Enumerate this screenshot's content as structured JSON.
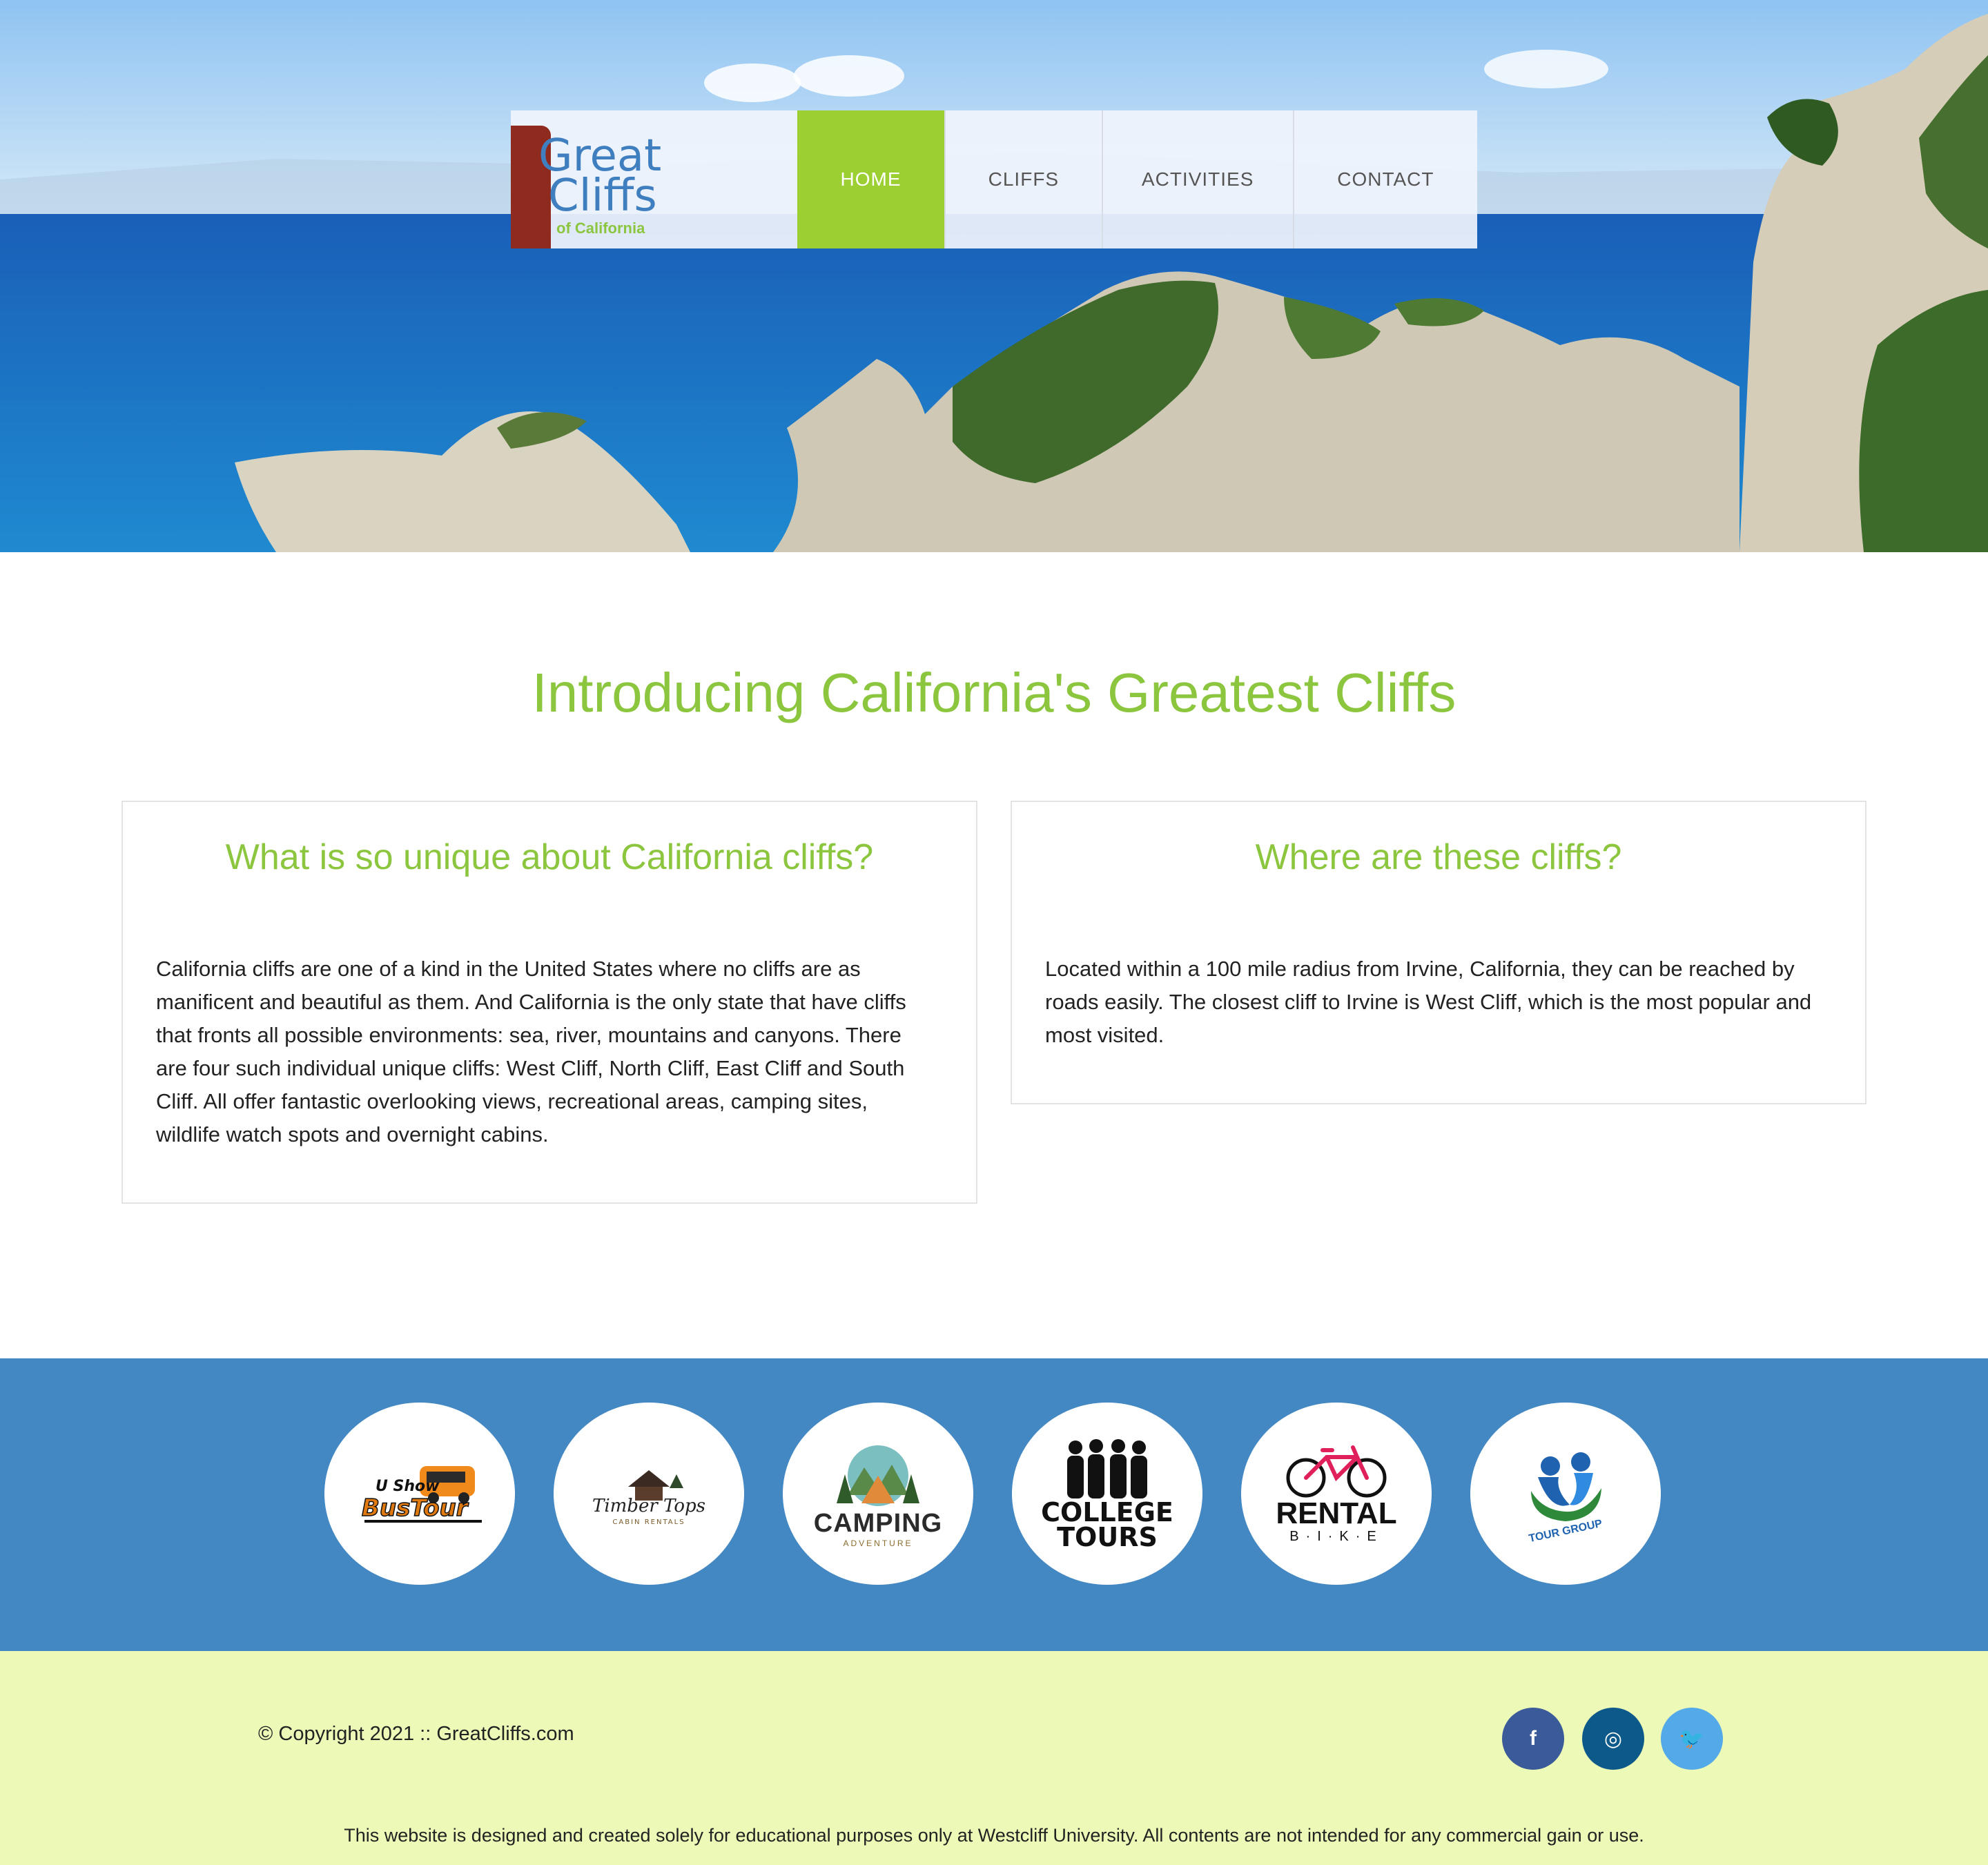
{
  "brand": {
    "logo_line1": "Great",
    "logo_line2": "Cliffs",
    "logo_line3": "of California"
  },
  "nav": {
    "items": [
      {
        "label": "HOME",
        "active": true
      },
      {
        "label": "CLIFFS",
        "active": false
      },
      {
        "label": "ACTIVITIES",
        "active": false
      },
      {
        "label": "CONTACT",
        "active": false
      }
    ]
  },
  "main": {
    "title": "Introducing California's Greatest Cliffs",
    "cards": [
      {
        "heading": "What is so unique about California cliffs?",
        "body": "California cliffs are one of a kind in the United States where no cliffs are as manificent and beautiful as them. And California is the only state that have cliffs that fronts all possible environments: sea, river, mountains and canyons. There are four such individual unique cliffs: West Cliff, North Cliff, East Cliff and South Cliff. All offer fantastic overlooking views, recreational areas, camping sites, wildlife watch spots and overnight cabins."
      },
      {
        "heading": "Where are these cliffs?",
        "body": "Located within a 100 mile radius from Irvine, California, they can be reached by roads easily. The closest cliff to Irvine is West Cliff, which is the most popular and most visited."
      }
    ]
  },
  "partners": {
    "bus": {
      "line1": "U Show",
      "line2": "BusTour"
    },
    "timber": {
      "line1": "Timber Tops",
      "line2": "CABIN RENTALS"
    },
    "camping": {
      "line1": "CAMPING",
      "line2": "ADVENTURE"
    },
    "college": {
      "line1": "COLLEGE",
      "line2": "TOURS"
    },
    "rental": {
      "line1": "RENTAL",
      "line2": "B·I·K·E"
    },
    "tour": {
      "line1": "TOUR GROUP"
    }
  },
  "footer": {
    "copyright": "© Copyright 2021 :: GreatCliffs.com",
    "disclaimer": "This website is designed and created solely for educational purposes only at Westcliff University. All contents are not intended for any commercial gain or use.",
    "social": {
      "facebook": "f",
      "instagram": "◎",
      "twitter": "🐦"
    }
  },
  "colors": {
    "accent_green": "#8cc63f",
    "nav_active": "#9ccf31",
    "partners_bg": "#4388c3",
    "footer_bg": "#ecf9b7",
    "facebook": "#3b5a9a",
    "instagram": "#0d5a8a",
    "twitter": "#54a9e9"
  }
}
